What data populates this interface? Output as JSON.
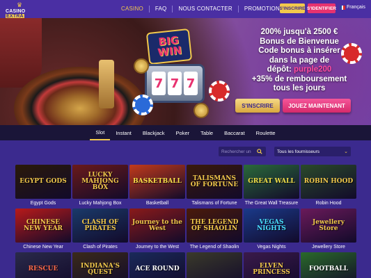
{
  "header": {
    "logo_text": "CASINO",
    "logo_brand": "EXTRA",
    "nav": [
      "CASINO",
      "FAQ",
      "NOUS CONTACTER",
      "PROMOTION"
    ],
    "btn_inscrire": "S'INSCRIRE",
    "btn_identifier": "S'IDENTIFIER",
    "language": "Français"
  },
  "hero": {
    "slot_badge": [
      "BIG",
      "WIN"
    ],
    "reels": [
      "7",
      "7",
      "7"
    ],
    "promo_line1": "200% jusqu'à 2500 €",
    "promo_line2": "Bonus de Bienvenue",
    "promo_line3": "Code bonus à insérer",
    "promo_line4": "dans la page de",
    "promo_line5_prefix": "dépôt: ",
    "promo_code": "purple200",
    "promo_line6": "+35% de remboursement",
    "promo_line7": "tous les jours",
    "btn_inscrire": "S'INSCRIRE",
    "btn_jouer": "JOUEZ MAINTENANT"
  },
  "categories": [
    "Slot",
    "Instant",
    "Blackjack",
    "Poker",
    "Table",
    "Baccarat",
    "Roulette"
  ],
  "active_category": "Slot",
  "filters": {
    "search_placeholder": "Rechercher un",
    "provider_value": "Tous les fournisseurs"
  },
  "games": [
    {
      "name": "Egypt Gods",
      "art": "EGYPT GODS",
      "bg": "#2a1a0a",
      "fg": "#f2c94c"
    },
    {
      "name": "Lucky Mahjong Box",
      "art": "LUCKY MAHJONG BOX",
      "bg": "#6a1a1a",
      "fg": "#f2c94c"
    },
    {
      "name": "Basketball",
      "art": "BASKETBALL",
      "bg": "#c23a1a",
      "fg": "#ffe04a"
    },
    {
      "name": "Talismans of Fortune",
      "art": "TALISMANS OF FORTUNE",
      "bg": "#3a1a0a",
      "fg": "#f2c94c"
    },
    {
      "name": "The Great Wall Treasure",
      "art": "GREAT WALL",
      "bg": "#2a6a3a",
      "fg": "#f2e04a"
    },
    {
      "name": "Robin Hood",
      "art": "ROBIN HOOD",
      "bg": "#2a4a2a",
      "fg": "#f2c94c"
    },
    {
      "name": "Chinese New Year",
      "art": "CHINESE NEW YEAR",
      "bg": "#b81a1a",
      "fg": "#f2c94c"
    },
    {
      "name": "Clash of Pirates",
      "art": "CLASH OF PIRATES",
      "bg": "#1a3a6a",
      "fg": "#f2c94c"
    },
    {
      "name": "Journey to the West",
      "art": "Journey to the West",
      "bg": "#8a1a1a",
      "fg": "#f2c94c"
    },
    {
      "name": "The Legend of Shaolin",
      "art": "THE LEGEND OF SHAOLIN",
      "bg": "#4a1a0a",
      "fg": "#f2c94c"
    },
    {
      "name": "Vegas Nights",
      "art": "VEGAS NIGHTS",
      "bg": "#1a3a8a",
      "fg": "#4ae0ff"
    },
    {
      "name": "Jewellery Store",
      "art": "Jewellery Store",
      "bg": "#6a1a5a",
      "fg": "#f2c94c"
    },
    {
      "name": "",
      "art": "RESCUE",
      "bg": "#2a2a4a",
      "fg": "#ff6a4a"
    },
    {
      "name": "",
      "art": "INDIANA'S QUEST",
      "bg": "#3a2a1a",
      "fg": "#f2c94c"
    },
    {
      "name": "",
      "art": "ACE ROUND",
      "bg": "#1a2a5a",
      "fg": "#ffffff"
    },
    {
      "name": "",
      "art": "",
      "bg": "#3a3a2a",
      "fg": "#f2c94c"
    },
    {
      "name": "",
      "art": "ELVEN PRINCESS",
      "bg": "#3a1a4a",
      "fg": "#f2c94c"
    },
    {
      "name": "",
      "art": "FOOTBALL",
      "bg": "#2a6a2a",
      "fg": "#ffffff"
    }
  ],
  "colors": {
    "page_bg": "#3b2a8e",
    "accent_gold": "#f2c94c",
    "accent_pink": "#e8326f"
  }
}
